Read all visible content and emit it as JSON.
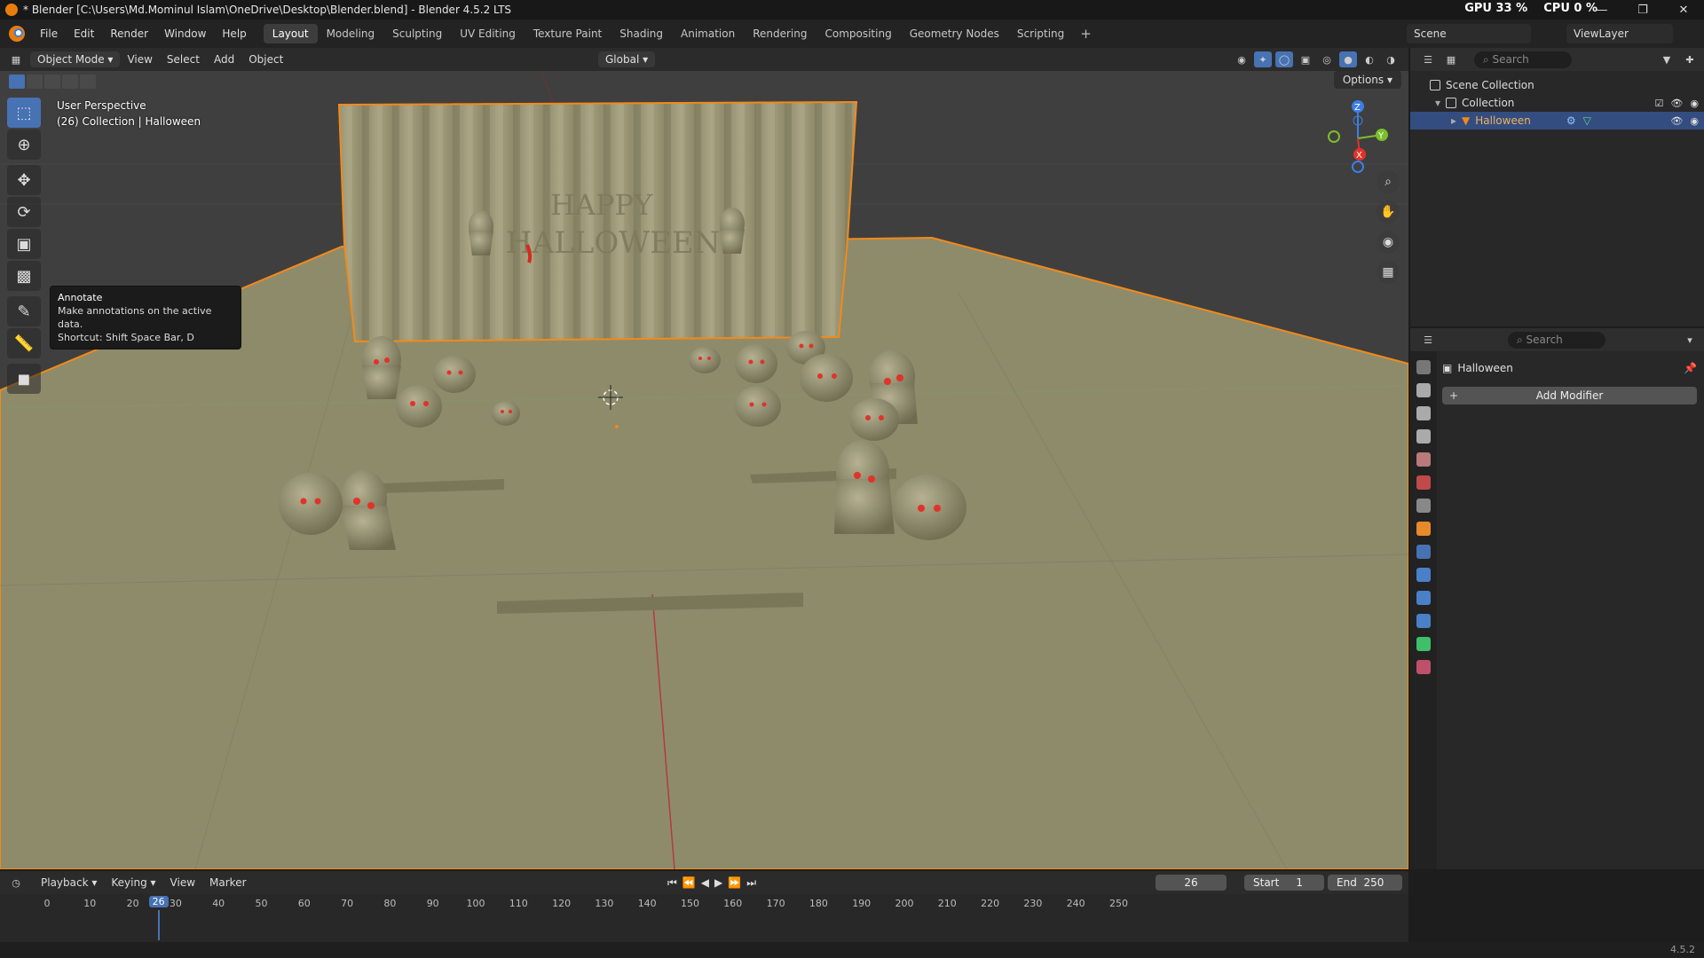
{
  "window": {
    "title": "* Blender [C:\\Users\\Md.Mominul Islam\\OneDrive\\Desktop\\Blender.blend] - Blender 4.5.2 LTS",
    "gpu": "GPU 33 %",
    "cpu": "CPU 0 %"
  },
  "menu": [
    "File",
    "Edit",
    "Render",
    "Window",
    "Help"
  ],
  "workspaces": [
    "Layout",
    "Modeling",
    "Sculpting",
    "UV Editing",
    "Texture Paint",
    "Shading",
    "Animation",
    "Rendering",
    "Compositing",
    "Geometry Nodes",
    "Scripting"
  ],
  "active_workspace": "Layout",
  "scene_name": "Scene",
  "view_layer": "ViewLayer",
  "viewport_header": {
    "mode": "Object Mode",
    "menus": [
      "View",
      "Select",
      "Add",
      "Object"
    ],
    "orientation": "Global"
  },
  "viewport": {
    "perspective": "User Perspective",
    "collection_info": "(26) Collection | Halloween",
    "options": "Options",
    "wall_text_1": "HAPPY",
    "wall_text_2": "HALLOWEEN",
    "colors": {
      "floor": "#8e8b6b",
      "wall": "#9c9877",
      "selection": "#f28a1a",
      "eyes": "#e0332a",
      "background": "#3f3f3f"
    }
  },
  "tooltip": {
    "title": "Annotate",
    "description": "Make annotations on the active data.",
    "shortcut": "Shortcut: Shift Space Bar, D"
  },
  "gizmo": {
    "x": "X",
    "y": "Y",
    "z": "Z"
  },
  "outliner": {
    "search_placeholder": "Search",
    "scene_collection": "Scene Collection",
    "collection": "Collection",
    "object": "Halloween"
  },
  "properties": {
    "search_placeholder": "Search",
    "object_name": "Halloween",
    "add_modifier": "Add Modifier"
  },
  "timeline": {
    "menus": [
      "Playback",
      "Keying",
      "View",
      "Marker"
    ],
    "current_frame": "26",
    "start_label": "Start",
    "start": "1",
    "end_label": "End",
    "end": "250",
    "ticks": [
      "0",
      "10",
      "20",
      "30",
      "40",
      "50",
      "60",
      "70",
      "80",
      "90",
      "100",
      "110",
      "120",
      "130",
      "140",
      "150",
      "160",
      "170",
      "180",
      "190",
      "200",
      "210",
      "220",
      "230",
      "240",
      "250"
    ]
  },
  "status": {
    "version": "4.5.2"
  }
}
